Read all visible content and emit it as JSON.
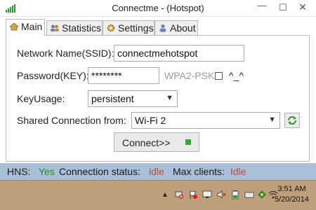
{
  "window": {
    "title": "Connectme - (Hotspot)",
    "minimize_glyph": "—",
    "maximize_glyph": "☐",
    "close_glyph": "✕"
  },
  "tabs": [
    {
      "label": "Main",
      "icon": "home-icon",
      "active": true
    },
    {
      "label": "Statistics",
      "icon": "users-icon",
      "active": false
    },
    {
      "label": "Settings",
      "icon": "gear-icon",
      "active": false
    },
    {
      "label": "About",
      "icon": "user-icon",
      "active": false
    }
  ],
  "main": {
    "network_name_label": "Network Name(SSID):",
    "network_name_value": "connectmehotspot",
    "password_label": "Password(KEY):",
    "password_value": "********",
    "security_label": "WPA2-PSK",
    "show_password_emoticon": "^_^",
    "key_usage_label": "KeyUsage:",
    "key_usage_value": "persistent",
    "shared_connection_label": "Shared Connection from:",
    "shared_connection_value": "Wi-Fi 2",
    "connect_button_label": "Connect>>"
  },
  "status": {
    "hns_label": "HNS:",
    "hns_value": "Yes",
    "connection_status_label": "Connection status:",
    "connection_status_value": "idle",
    "max_clients_label": "Max clients:",
    "max_clients_value": "Idle"
  },
  "taskbar": {
    "time": "3:51 AM",
    "date": "5/20/2014",
    "tray_icons": [
      "network-warning-icon",
      "flag-icon",
      "monitor-icon",
      "volume-muted-icon",
      "battery-icon",
      "keyboard-icon",
      "wifi-icon",
      "app-icon"
    ]
  },
  "colors": {
    "status_bar": "#a9bfd8",
    "status_green": "#2a8a2a",
    "status_red": "#c04a3a",
    "taskbar": "#bda07a",
    "connect_indicator": "#33a833"
  }
}
